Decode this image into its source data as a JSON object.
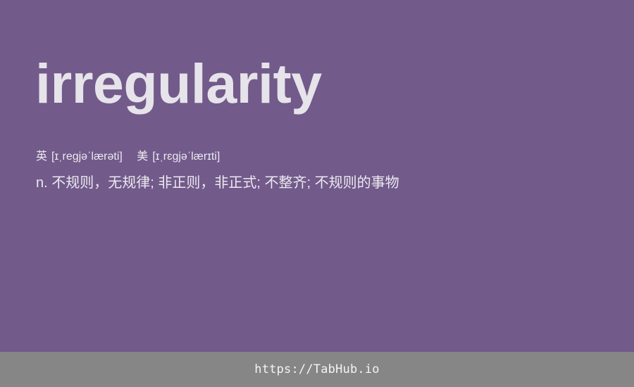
{
  "entry": {
    "word": "irregularity",
    "phonetics": [
      {
        "label": "英",
        "ipa": "[ɪˌregjəˈlærəti]"
      },
      {
        "label": "美",
        "ipa": "[ɪˌrɛɡjəˈlærɪti]"
      }
    ],
    "definition": "n. 不规则，无规律; 非正则，非正式; 不整齐; 不规则的事物"
  },
  "footer": {
    "link_text": "https://TabHub.io"
  },
  "colors": {
    "background": "#725a8a",
    "footer_background": "#868686",
    "text": "#e6e3ea"
  }
}
